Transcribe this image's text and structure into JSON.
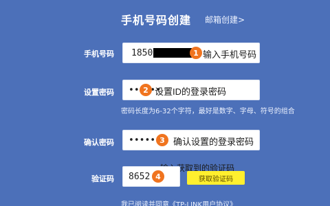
{
  "header": {
    "title": "手机号码创建",
    "email_link": "邮箱创建>"
  },
  "form": {
    "phone": {
      "label": "手机号码",
      "value": "1850",
      "step": "1",
      "annotation": "输入手机号码"
    },
    "password": {
      "label": "设置密码",
      "value": "••••••",
      "step": "2",
      "annotation": "设置ID的登录密码",
      "hint": "密码长度为6-32个字符，最好是数字、字母、符号的组合"
    },
    "confirm_password": {
      "label": "确认密码",
      "value": "••••••",
      "step": "3",
      "annotation": "确认设置的登录密码"
    },
    "verification_code": {
      "label": "验证码",
      "value": "8652",
      "step": "4",
      "annotation": "输入获取到的验证码",
      "get_code_button": "获取验证码"
    }
  },
  "footer": {
    "agreement": "我已阅读并同意《TP-LINK用户协议》"
  },
  "colors": {
    "background": "#4c70b9",
    "badge": "#f0741f",
    "button": "#ffef2e"
  }
}
